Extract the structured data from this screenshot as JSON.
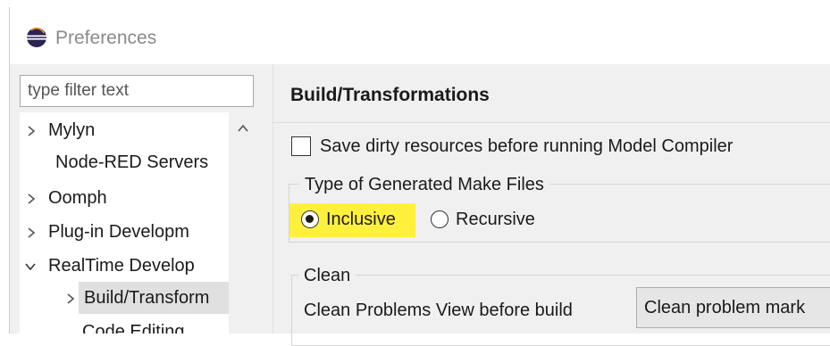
{
  "window": {
    "title": "Preferences",
    "icon": "eclipse-icon"
  },
  "filter": {
    "placeholder": "type filter text"
  },
  "tree": {
    "items": [
      {
        "label": "Mylyn",
        "expander": "collapsed"
      },
      {
        "label": "Node-RED Servers",
        "expander": "none"
      },
      {
        "label": "Oomph",
        "expander": "collapsed"
      },
      {
        "label": "Plug-in Developm",
        "expander": "collapsed"
      },
      {
        "label": "RealTime Develop",
        "expander": "expanded"
      },
      {
        "label": "Build/Transform",
        "expander": "collapsed",
        "selected": true
      },
      {
        "label": "Code Editing",
        "expander": "none"
      }
    ]
  },
  "page": {
    "title": "Build/Transformations",
    "save_dirty_label": "Save dirty resources before running Model Compiler",
    "save_dirty_checked": false,
    "make_files": {
      "group_title": "Type of Generated Make Files",
      "options": [
        {
          "label": "Inclusive",
          "selected": true
        },
        {
          "label": "Recursive",
          "selected": false
        }
      ]
    },
    "clean": {
      "group_title": "Clean",
      "problems_label": "Clean Problems View before build",
      "problems_value": "Clean problem mark"
    }
  },
  "colors": {
    "highlight": "#fff03c",
    "panel": "#f0f0f0"
  }
}
